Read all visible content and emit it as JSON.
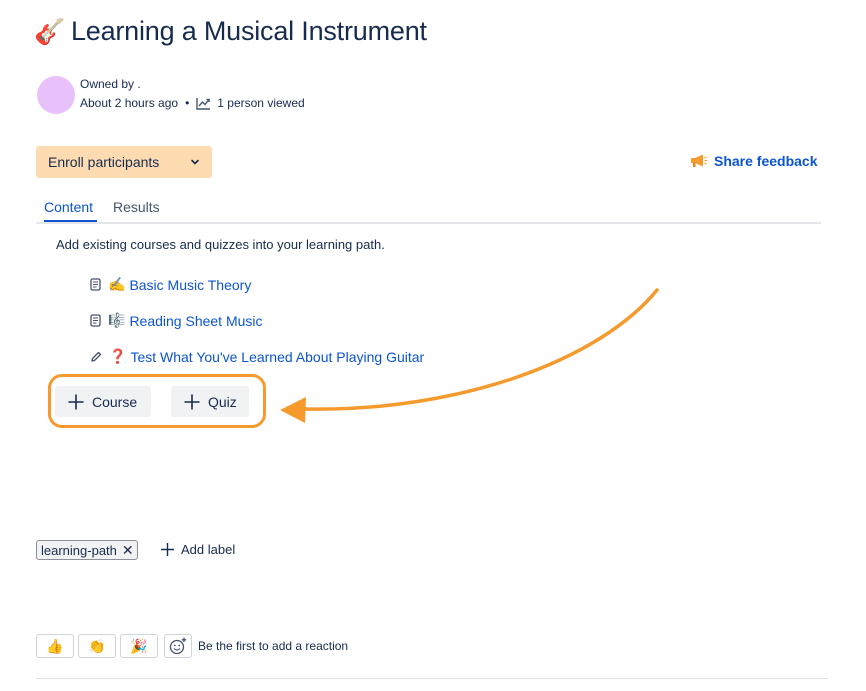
{
  "page": {
    "title_emoji": "🎸",
    "title": "Learning a Musical Instrument"
  },
  "byline": {
    "owned_by": "Owned by .",
    "time": "About 2 hours ago",
    "separator": "•",
    "views": "1 person viewed"
  },
  "toolbar": {
    "enroll_label": "Enroll participants",
    "share_label": "Share feedback"
  },
  "tabs": [
    {
      "label": "Content",
      "active": true
    },
    {
      "label": "Results",
      "active": false
    }
  ],
  "content": {
    "helper": "Add existing courses and quizzes into your learning path.",
    "items": [
      {
        "kind": "course",
        "emoji": "✍️",
        "title": "Basic Music Theory"
      },
      {
        "kind": "course",
        "emoji": "🎼",
        "title": "Reading Sheet Music"
      },
      {
        "kind": "quiz",
        "emoji": "❓",
        "title": "Test What You've Learned About Playing Guitar"
      }
    ],
    "add_course_label": "Course",
    "add_quiz_label": "Quiz"
  },
  "labels": {
    "items": [
      "learning-path"
    ],
    "remove_glyph": "✕",
    "add_label": "Add label"
  },
  "reactions": {
    "emojis": [
      "👍",
      "👏",
      "🎉"
    ],
    "prompt": "Be the first to add a reaction"
  },
  "colors": {
    "accent": "#0c55cf",
    "enroll_bg": "#fedbb1",
    "highlight": "#f59a2d",
    "avatar": "#e8c1fb"
  }
}
